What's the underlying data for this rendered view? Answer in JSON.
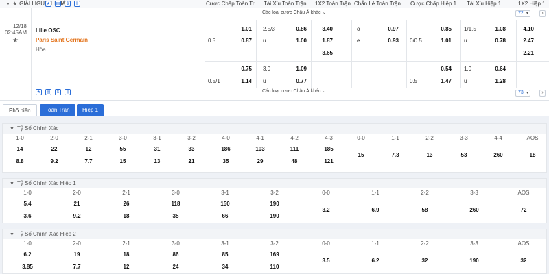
{
  "header": {
    "league": "GIẢI LIGUE 1 PHÁP",
    "cols": [
      "Cược Chấp Toàn Tr...",
      "Tài Xỉu Toàn Trận",
      "1X2 Toàn Trận",
      "Chẵn Lẻ Toàn Trận",
      "Cược Chấp Hiệp 1",
      "Tài Xỉu Hiệp 1",
      "1X2 Hiệp 1"
    ]
  },
  "event": {
    "date": "12/18",
    "time": "02:45AM",
    "home": "Lille OSC",
    "away": "Paris Saint Germain",
    "draw": "Hòa",
    "more_label": "Các loại cược Châu Á khác",
    "count1": "72",
    "count2": "73",
    "block1": {
      "hdp_ft": [
        [
          "",
          "1.01"
        ],
        [
          "0.5",
          "0.87"
        ]
      ],
      "ou_ft": [
        [
          "2.5/3",
          "0.86"
        ],
        [
          "u",
          "1.00"
        ]
      ],
      "x12_ft": [
        "3.40",
        "1.87",
        "3.65"
      ],
      "oe_ft": [
        [
          "o",
          "0.97"
        ],
        [
          "e",
          "0.93"
        ]
      ],
      "hdp_h1": [
        [
          "",
          "0.85"
        ],
        [
          "0/0.5",
          "1.01"
        ]
      ],
      "ou_h1": [
        [
          "1/1.5",
          "1.08"
        ],
        [
          "u",
          "0.78"
        ]
      ],
      "x12_h1": [
        "4.10",
        "2.47",
        "2.21"
      ]
    },
    "block2": {
      "hdp_ft": [
        [
          "",
          "0.75"
        ],
        [
          "0.5/1",
          "1.14"
        ]
      ],
      "ou_ft": [
        [
          "3.0",
          "1.09"
        ],
        [
          "u",
          "0.77"
        ]
      ],
      "hdp_h1": [
        [
          "",
          "0.54"
        ],
        [
          "0.5",
          "1.47"
        ]
      ],
      "ou_h1": [
        [
          "1.0",
          "0.64"
        ],
        [
          "u",
          "1.28"
        ]
      ]
    }
  },
  "tabs": [
    "Phổ biến",
    "Toàn Trận",
    "Hiệp 1"
  ],
  "sections": [
    {
      "title": "Tỷ Số Chính Xác",
      "heads": [
        "1-0",
        "2-0",
        "2-1",
        "3-0",
        "3-1",
        "3-2",
        "4-0",
        "4-1",
        "4-2",
        "4-3",
        "0-0",
        "1-1",
        "2-2",
        "3-3",
        "4-4",
        "AOS"
      ],
      "row1": [
        "14",
        "22",
        "12",
        "55",
        "31",
        "33",
        "186",
        "103",
        "111",
        "185"
      ],
      "row2": [
        "8.8",
        "9.2",
        "7.7",
        "15",
        "13",
        "21",
        "35",
        "29",
        "48",
        "121"
      ],
      "mid": [
        "15",
        "7.3",
        "13",
        "53",
        "260",
        "18"
      ]
    },
    {
      "title": "Tỷ Số Chính Xác Hiệp 1",
      "heads": [
        "1-0",
        "2-0",
        "2-1",
        "3-0",
        "3-1",
        "3-2",
        "0-0",
        "1-1",
        "2-2",
        "3-3",
        "AOS"
      ],
      "row1": [
        "5.4",
        "21",
        "26",
        "118",
        "150",
        "190"
      ],
      "row2": [
        "3.6",
        "9.2",
        "18",
        "35",
        "66",
        "190"
      ],
      "mid": [
        "3.2",
        "6.9",
        "58",
        "260",
        "72"
      ]
    },
    {
      "title": "Tỷ Số Chính Xác Hiệp 2",
      "heads": [
        "1-0",
        "2-0",
        "2-1",
        "3-0",
        "3-1",
        "3-2",
        "0-0",
        "1-1",
        "2-2",
        "3-3",
        "AOS"
      ],
      "row1": [
        "6.2",
        "19",
        "18",
        "86",
        "85",
        "169"
      ],
      "row2": [
        "3.85",
        "7.7",
        "12",
        "24",
        "34",
        "110"
      ],
      "mid": [
        "3.5",
        "6.2",
        "32",
        "190",
        "32"
      ]
    }
  ],
  "icons": [
    "star-icon",
    "mail-icon",
    "dollar-icon",
    "stats-icon"
  ]
}
